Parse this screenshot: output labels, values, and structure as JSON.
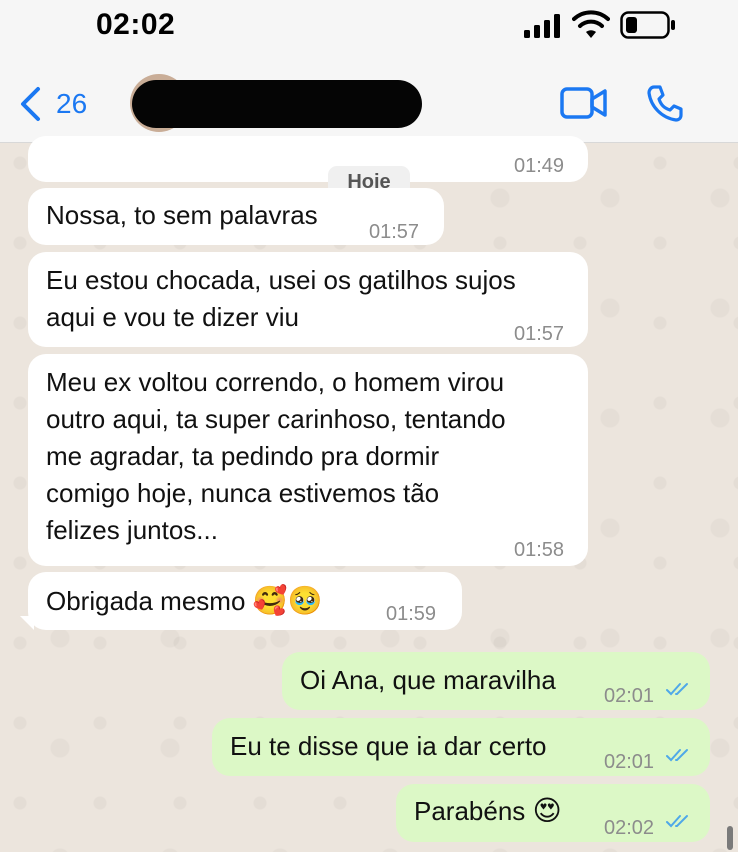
{
  "status_bar": {
    "time": "02:02"
  },
  "header": {
    "back_count": "26",
    "icons": [
      "chevron-left-icon",
      "video-camera-icon",
      "phone-icon"
    ],
    "accent_color": "#1b78f2"
  },
  "date_separator": "Hoje",
  "messages": [
    {
      "direction": "in",
      "text": "",
      "time": "01:49"
    },
    {
      "direction": "in",
      "text": "Nossa, to sem palavras",
      "time": "01:57"
    },
    {
      "direction": "in",
      "lines": [
        "Eu estou chocada, usei os gatilhos sujos",
        "aqui e vou te dizer viu"
      ],
      "time": "01:57"
    },
    {
      "direction": "in",
      "lines": [
        "Meu ex voltou correndo, o homem virou",
        "outro aqui, ta super carinhoso, tentando",
        "me agradar, ta pedindo pra dormir",
        "comigo hoje, nunca estivemos tão",
        "felizes juntos..."
      ],
      "time": "01:58"
    },
    {
      "direction": "in",
      "text": "Obrigada mesmo",
      "emoji": "🥰🥹",
      "time": "01:59"
    },
    {
      "direction": "out",
      "text": "Oi Ana, que maravilha",
      "time": "02:01",
      "status": "read"
    },
    {
      "direction": "out",
      "text": "Eu te disse que ia dar certo",
      "time": "02:01",
      "status": "read"
    },
    {
      "direction": "out",
      "text": "Parabéns",
      "emoji": "😍",
      "time": "02:02",
      "status": "read"
    }
  ],
  "colors": {
    "incoming": "#ffffff",
    "outgoing": "#dcf8c6",
    "read_ticks": "#4fa8e8"
  }
}
